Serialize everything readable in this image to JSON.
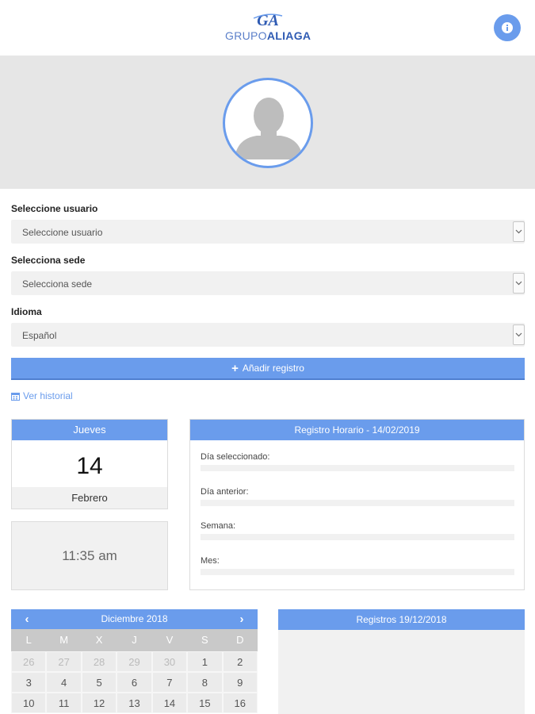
{
  "header": {
    "logo_mark": "GA",
    "logo_text_light": "GRUPO",
    "logo_text_bold": "ALIAGA"
  },
  "form": {
    "user_label": "Seleccione usuario",
    "user_value": "Seleccione usuario",
    "site_label": "Selecciona sede",
    "site_value": "Selecciona sede",
    "language_label": "Idioma",
    "language_value": "Español"
  },
  "actions": {
    "add_label": "Añadir registro",
    "history_label": "Ver historial"
  },
  "today": {
    "weekday": "Jueves",
    "day": "14",
    "month": "Febrero",
    "time": "11:35 am"
  },
  "registro": {
    "title": "Registro Horario - 14/02/2019",
    "rows": [
      "Día seleccionado:",
      "Día anterior:",
      "Semana:",
      "Mes:"
    ]
  },
  "calendar": {
    "title": "Diciembre 2018",
    "weekdays": [
      "L",
      "M",
      "X",
      "J",
      "V",
      "S",
      "D"
    ],
    "weeks": [
      [
        {
          "d": "26",
          "muted": true
        },
        {
          "d": "27",
          "muted": true
        },
        {
          "d": "28",
          "muted": true
        },
        {
          "d": "29",
          "muted": true
        },
        {
          "d": "30",
          "muted": true
        },
        {
          "d": "1",
          "muted": false
        },
        {
          "d": "2",
          "muted": false
        }
      ],
      [
        {
          "d": "3",
          "muted": false
        },
        {
          "d": "4",
          "muted": false
        },
        {
          "d": "5",
          "muted": false
        },
        {
          "d": "6",
          "muted": false
        },
        {
          "d": "7",
          "muted": false
        },
        {
          "d": "8",
          "muted": false
        },
        {
          "d": "9",
          "muted": false
        }
      ],
      [
        {
          "d": "10",
          "muted": false
        },
        {
          "d": "11",
          "muted": false
        },
        {
          "d": "12",
          "muted": false
        },
        {
          "d": "13",
          "muted": false
        },
        {
          "d": "14",
          "muted": false
        },
        {
          "d": "15",
          "muted": false
        },
        {
          "d": "16",
          "muted": false
        }
      ]
    ]
  },
  "registros_panel": {
    "title": "Registros 19/12/2018"
  },
  "colors": {
    "accent": "#6a9cec",
    "panel_gray": "#f1f1f1",
    "banner_gray": "#e6e6e6"
  }
}
